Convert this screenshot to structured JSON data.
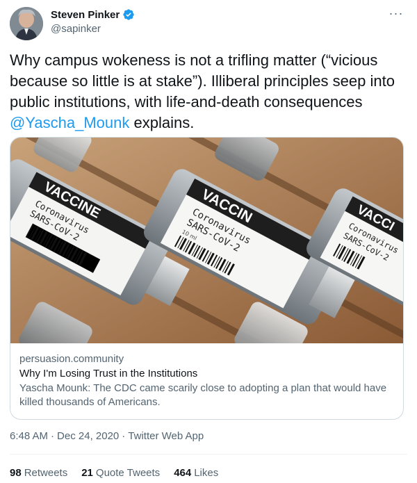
{
  "author": {
    "display_name": "Steven Pinker",
    "handle": "@sapinker",
    "verified_icon": "verified-badge-icon",
    "avatar_icon": "avatar"
  },
  "tweet": {
    "text_before": "Why campus wokeness is not a trifling matter (“vicious because so little is at stake”). Illiberal principles seep into public institutions, with life-and-death consequences ",
    "mention": "@Yascha_Mounk",
    "text_after": " explains."
  },
  "card": {
    "image_labels": {
      "vial_left": "VACCINE",
      "vial_left_sub1": "Coronavirus",
      "vial_left_sub2": "SARS-CoV-2",
      "vial_center": "VACCIN",
      "vial_center_sub1": "Coronavirus",
      "vial_center_sub2": "SARS-CoV-2",
      "vial_center_vol": "10 ml",
      "vial_right": "VACCI",
      "vial_right_sub1": "Coronavirus",
      "vial_right_sub2": "SARS-CoV-2"
    },
    "domain": "persuasion.community",
    "title": "Why I'm Losing Trust in the Institutions",
    "description": "Yascha Mounk: The CDC came scarily close to adopting a plan that would have killed thousands of Americans."
  },
  "meta": {
    "time": "6:48 AM",
    "date": "Dec 24, 2020",
    "source": "Twitter Web App",
    "sep": "·"
  },
  "stats": {
    "retweets_count": "98",
    "retweets_label": "Retweets",
    "quotes_count": "21",
    "quotes_label": "Quote Tweets",
    "likes_count": "464",
    "likes_label": "Likes"
  },
  "colors": {
    "link": "#1d9bf0",
    "secondary": "#536471",
    "text": "#0f1419"
  }
}
